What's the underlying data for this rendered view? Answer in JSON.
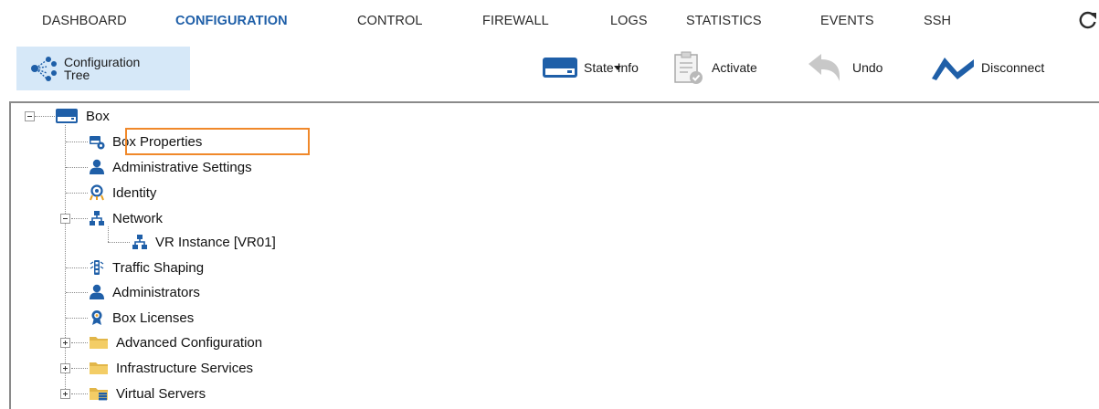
{
  "nav": {
    "tabs": [
      "DASHBOARD",
      "CONFIGURATION",
      "CONTROL",
      "FIREWALL",
      "LOGS",
      "STATISTICS",
      "EVENTS",
      "SSH"
    ],
    "active_tab": "CONFIGURATION"
  },
  "toolbar": {
    "config_tree_label": "Configuration Tree",
    "state_info_label": "State Info",
    "activate_label": "Activate",
    "undo_label": "Undo",
    "disconnect_label": "Disconnect"
  },
  "tree": {
    "root": "Box",
    "items": [
      {
        "label": "Box Properties",
        "icon": "box-properties-icon"
      },
      {
        "label": "Administrative Settings",
        "icon": "admin-user-icon"
      },
      {
        "label": "Identity",
        "icon": "identity-icon"
      },
      {
        "label": "Network",
        "icon": "network-icon"
      },
      {
        "label": "VR Instance [VR01]",
        "icon": "network-icon"
      },
      {
        "label": "Traffic Shaping",
        "icon": "traffic-shaping-icon"
      },
      {
        "label": "Administrators",
        "icon": "admin-user-icon"
      },
      {
        "label": "Box Licenses",
        "icon": "license-icon"
      },
      {
        "label": "Advanced Configuration",
        "icon": "folder-icon"
      },
      {
        "label": "Infrastructure Services",
        "icon": "folder-icon"
      },
      {
        "label": "Virtual Servers",
        "icon": "virtual-servers-folder-icon"
      }
    ]
  },
  "colors": {
    "active_tab": "#1f5fa8",
    "selected_button_bg": "#d6e8f8",
    "highlight_border": "#f0882a",
    "icon_blue": "#1f5fa8"
  }
}
